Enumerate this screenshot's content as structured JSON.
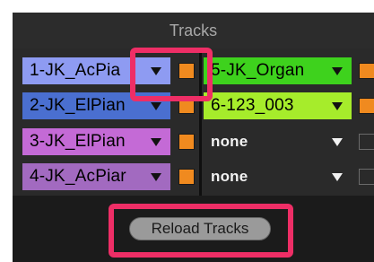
{
  "panel": {
    "title": "Tracks"
  },
  "tracks_left": [
    {
      "label": "1-JK_AcPia",
      "color": "#8e9bf2",
      "text_color": "#111111",
      "enabled": true
    },
    {
      "label": "2-JK_ElPian",
      "color": "#4a6fd0",
      "text_color": "#111111",
      "enabled": true
    },
    {
      "label": "3-JK_ElPian",
      "color": "#c46ad6",
      "text_color": "#111111",
      "enabled": true
    },
    {
      "label": "4-JK_AcPiar",
      "color": "#a26ac0",
      "text_color": "#111111",
      "enabled": true
    }
  ],
  "tracks_right": [
    {
      "label": "5-JK_Organ",
      "color": "#3ed21d",
      "enabled": true
    },
    {
      "label": "6-123_003",
      "color": "#a6ec2b",
      "enabled": true
    },
    {
      "label": "none",
      "color": "#2a2a2a",
      "enabled": false
    },
    {
      "label": "none",
      "color": "#2a2a2a",
      "enabled": false
    }
  ],
  "footer": {
    "reload_label": "Reload Tracks"
  },
  "colors": {
    "highlight": "#ee2e66",
    "arm_orange": "#f08a1f"
  }
}
